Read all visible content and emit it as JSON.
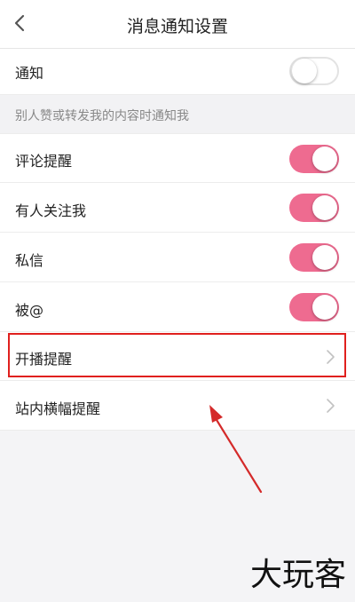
{
  "header": {
    "title": "消息通知设置"
  },
  "rows": {
    "notify": {
      "label": "通知",
      "enabled": false
    },
    "section_header": "别人赞或转发我的内容时通知我",
    "comment": {
      "label": "评论提醒",
      "enabled": true
    },
    "follow": {
      "label": "有人关注我",
      "enabled": true
    },
    "message": {
      "label": "私信",
      "enabled": true
    },
    "mention": {
      "label": "被@",
      "enabled": true
    },
    "live": {
      "label": "开播提醒"
    },
    "banner": {
      "label": "站内横幅提醒"
    }
  },
  "watermark": "大玩客",
  "colors": {
    "toggle_on": "#ee6b90",
    "highlight": "#e0201e",
    "arrow": "#d42a2a"
  },
  "icons": [
    "back-arrow-icon",
    "chevron-right-icon"
  ]
}
